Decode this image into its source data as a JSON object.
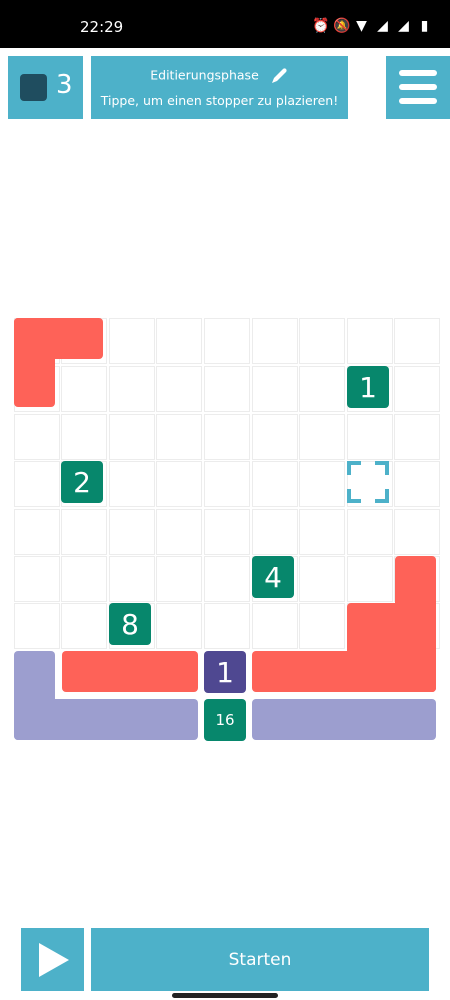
{
  "status_bar": {
    "time": "22:29",
    "icons": [
      "alarm-icon",
      "mute-icon",
      "wifi-icon",
      "signal-icon",
      "signal-icon",
      "battery-icon"
    ]
  },
  "header": {
    "counter_value": "3",
    "phase_label": "Editierungsphase",
    "hint": "Tippe, um einen stopper zu plazieren!",
    "menu_icon": "hamburger-menu-icon"
  },
  "board": {
    "number_tiles": [
      "1",
      "2",
      "4",
      "8",
      "1",
      "16"
    ]
  },
  "footer": {
    "start_label": "Starten",
    "play_icon": "play-icon"
  },
  "colors": {
    "accent": "#4db1c9",
    "tile_green": "#07876c",
    "tile_purple": "#4f4891",
    "wall_red": "#fe6258",
    "wall_lavender": "#9c9ecf",
    "counter_square": "#1f4d5f"
  }
}
